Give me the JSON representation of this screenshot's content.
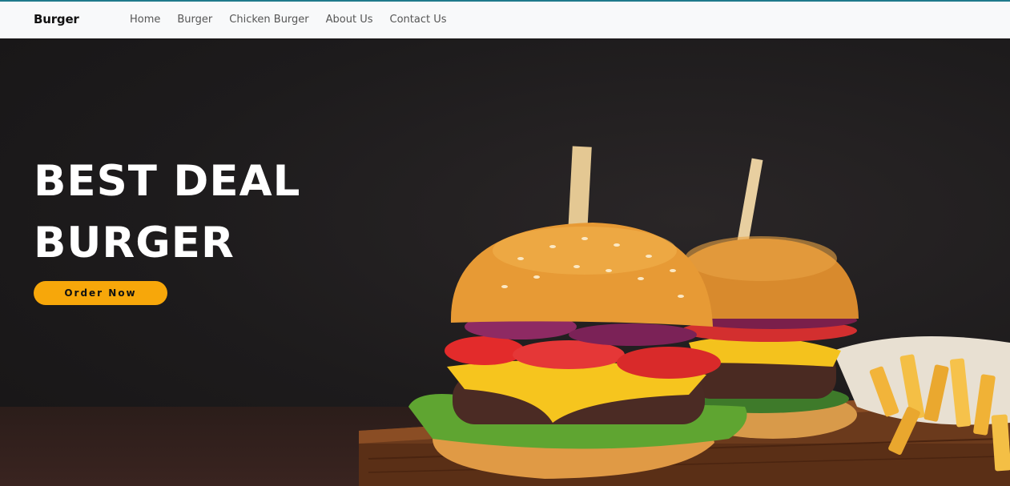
{
  "navbar": {
    "brand": "Burger",
    "links": [
      "Home",
      "Burger",
      "Chicken Burger",
      "About Us",
      "Contact Us"
    ]
  },
  "hero": {
    "title_line1": "BEST DEAL",
    "title_line2": "BURGER",
    "cta_label": "Order Now"
  },
  "colors": {
    "accent": "#f7a70a",
    "navbar_bg": "#f8f9fa",
    "hero_bg": "#1c1a1b"
  }
}
